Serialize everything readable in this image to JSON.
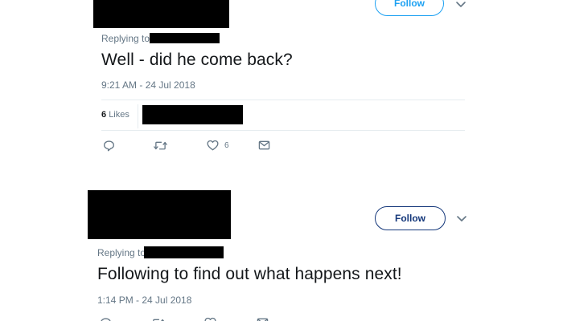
{
  "colors": {
    "follow_blue": "#1da1f2",
    "follow_navy": "#14377a",
    "meta_gray": "#657786",
    "divider": "#e6ecf0",
    "redaction": "#000000"
  },
  "tweets": [
    {
      "follow_label": "Follow",
      "replying_label": "Replying to",
      "text": "Well - did he come back?",
      "timestamp": "9:21 AM - 24 Jul 2018",
      "likes_count": "6",
      "likes_label": "Likes",
      "actions": {
        "reply_icon": "reply-icon",
        "retweet_icon": "retweet-icon",
        "like_icon": "heart-icon",
        "like_count": "6",
        "message_icon": "envelope-icon"
      }
    },
    {
      "follow_label": "Follow",
      "replying_label": "Replying to",
      "text": "Following to find out what happens next!",
      "timestamp": "1:14 PM - 24 Jul 2018",
      "actions": {
        "reply_icon": "reply-icon",
        "retweet_icon": "retweet-icon",
        "like_icon": "heart-icon",
        "message_icon": "envelope-icon"
      }
    }
  ]
}
